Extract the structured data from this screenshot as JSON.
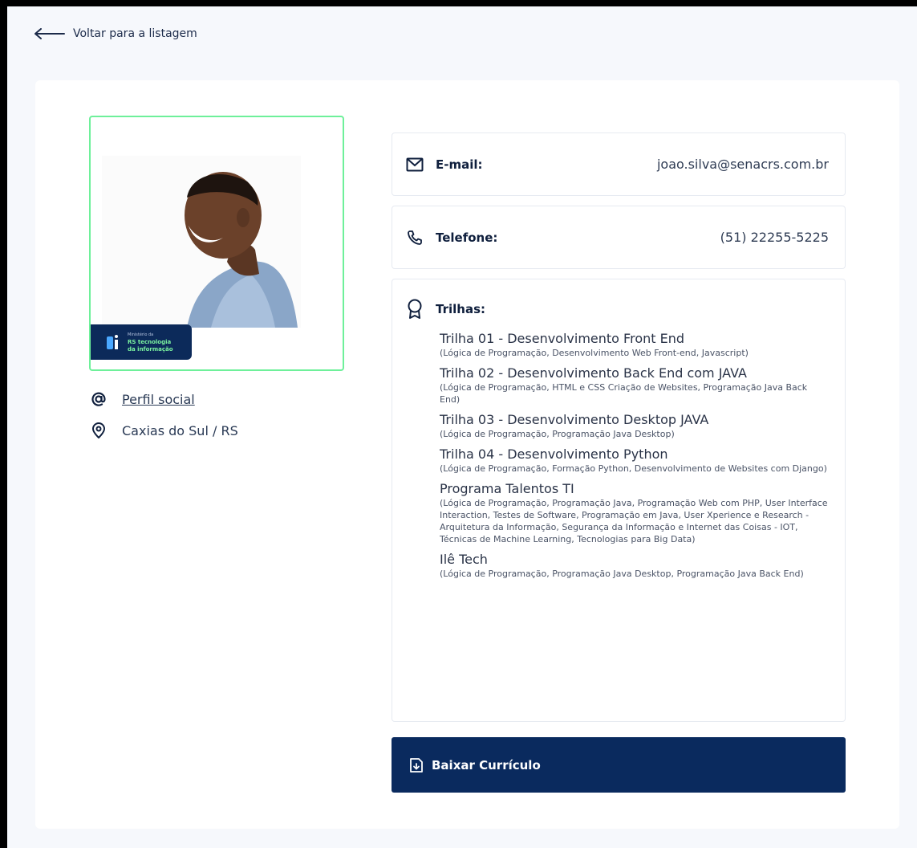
{
  "nav": {
    "back_label": "Voltar para a listagem"
  },
  "profile": {
    "logo_small": "Ministério da",
    "logo_line1": "RS tecnologia",
    "logo_line2": "da informação",
    "social_link": "Perfil social",
    "location": "Caxias do Sul / RS"
  },
  "contact": {
    "email_label": "E-mail:",
    "email_value": "joao.silva@senacrs.com.br",
    "phone_label": "Telefone:",
    "phone_value": "(51) 22255-5225"
  },
  "trilhas": {
    "label": "Trilhas:",
    "items": [
      {
        "name": "Trilha 01 - Desenvolvimento Front End",
        "desc": "(Lógica de Programação, Desenvolvimento Web Front-end, Javascript)"
      },
      {
        "name": "Trilha 02 - Desenvolvimento Back End com JAVA",
        "desc": "(Lógica de Programação, HTML e CSS Criação de Websites, Programação Java Back End)"
      },
      {
        "name": "Trilha 03 - Desenvolvimento Desktop JAVA",
        "desc": "(Lógica de Programação, Programação Java Desktop)"
      },
      {
        "name": "Trilha 04 - Desenvolvimento Python",
        "desc": "(Lógica de Programação, Formação Python, Desenvolvimento de Websites com Django)"
      },
      {
        "name": "Programa Talentos TI",
        "desc": "(Lógica de Programação, Programação Java, Programação Web com PHP, User Interface Interaction, Testes de Software, Programação em Java, User Xperience e Research - Arquitetura da Informação, Segurança da Informação e Internet das Coisas - IOT, Técnicas de Machine Learning, Tecnologias para Big Data)"
      },
      {
        "name": "Ilê Tech",
        "desc": "(Lógica de Programação, Programação Java Desktop, Programação Java Back End)"
      }
    ]
  },
  "actions": {
    "download_label": "Baixar Currículo"
  },
  "colors": {
    "accent_dark": "#0a2a5e",
    "photo_border": "#6ef09a"
  }
}
